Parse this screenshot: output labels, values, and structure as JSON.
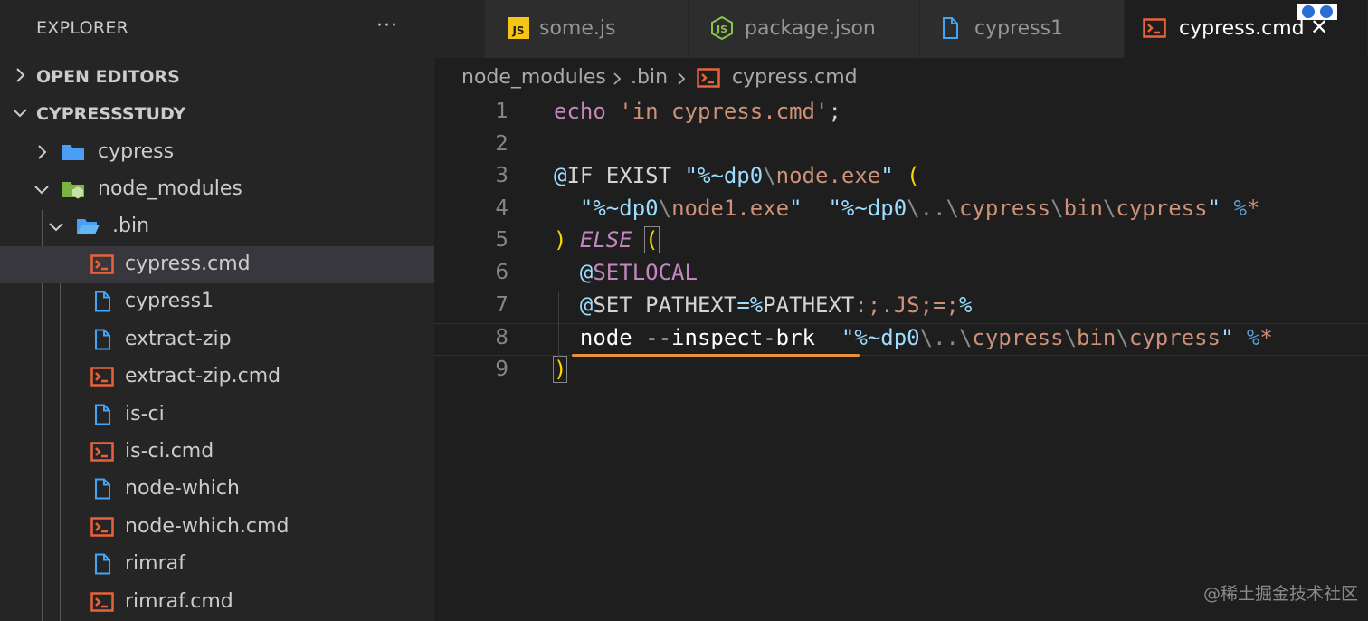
{
  "sidebar": {
    "title": "EXPLORER",
    "more_label": "···",
    "sections": {
      "open_editors": "OPEN EDITORS",
      "project": "CYPRESSSTUDY"
    },
    "tree": [
      {
        "label": "cypress",
        "icon": "folder-icon"
      },
      {
        "label": "node_modules",
        "icon": "node-folder-icon"
      },
      {
        "label": ".bin",
        "icon": "folder-open-icon"
      },
      {
        "label": "cypress.cmd",
        "icon": "terminal-file-icon",
        "selected": true
      },
      {
        "label": "cypress1",
        "icon": "file-icon"
      },
      {
        "label": "extract-zip",
        "icon": "file-icon"
      },
      {
        "label": "extract-zip.cmd",
        "icon": "terminal-file-icon"
      },
      {
        "label": "is-ci",
        "icon": "file-icon"
      },
      {
        "label": "is-ci.cmd",
        "icon": "terminal-file-icon"
      },
      {
        "label": "node-which",
        "icon": "file-icon"
      },
      {
        "label": "node-which.cmd",
        "icon": "terminal-file-icon"
      },
      {
        "label": "rimraf",
        "icon": "file-icon"
      },
      {
        "label": "rimraf.cmd",
        "icon": "terminal-file-icon"
      }
    ]
  },
  "tabs": [
    {
      "label": "some.js",
      "icon": "js-file-icon"
    },
    {
      "label": "package.json",
      "icon": "nodejs-icon"
    },
    {
      "label": "cypress1",
      "icon": "file-icon"
    },
    {
      "label": "cypress.cmd",
      "icon": "terminal-file-icon",
      "active": true,
      "close": "✕"
    }
  ],
  "breadcrumb": [
    "node_modules",
    ".bin",
    "cypress.cmd"
  ],
  "editor": {
    "line_numbers": [
      "1",
      "2",
      "3",
      "4",
      "5",
      "6",
      "7",
      "8",
      "9"
    ],
    "current_line": 8,
    "lines": [
      "echo 'in cypress.cmd';",
      "",
      "@IF EXIST \"%~dp0\\node.exe\" (",
      "  \"%~dp0\\node1.exe\"  \"%~dp0\\..\\cypress\\bin\\cypress\" %*",
      ") ELSE (",
      "  @SETLOCAL",
      "  @SET PATHEXT=%PATHEXT:;.JS;=;%",
      "  node --inspect-brk  \"%~dp0\\..\\cypress\\bin\\cypress\" %*",
      ")"
    ]
  },
  "colors": {
    "keyword": "#c586c0",
    "string": "#ce9178",
    "underline": "#e8913a"
  },
  "watermark": "@稀土掘金技术社区"
}
